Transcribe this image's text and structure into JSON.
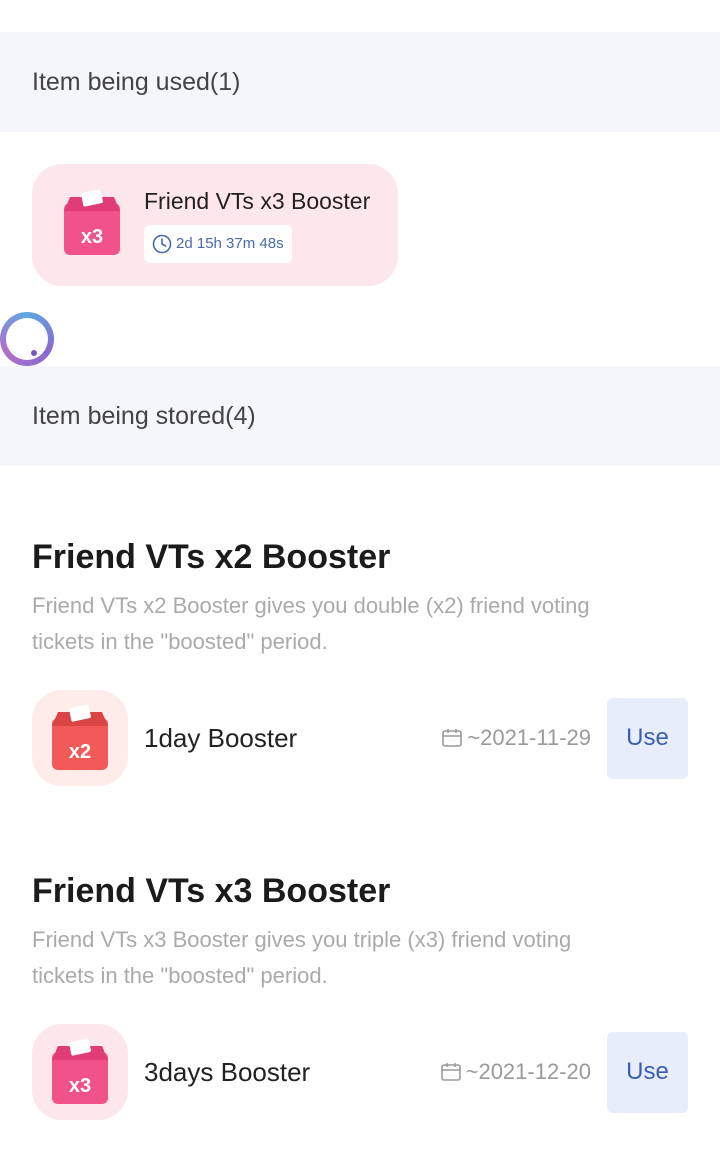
{
  "in_use": {
    "header": "Item being used(1)",
    "card": {
      "title": "Friend VTs x3 Booster",
      "timer": "2d 15h 37m 48s",
      "badge": "x3"
    }
  },
  "stored": {
    "header": "Item being stored(4)",
    "products": [
      {
        "title": "Friend VTs x2 Booster",
        "desc_line1": "Friend VTs x2 Booster gives you double (x2) friend voting",
        "desc_line2": "tickets in the \"boosted\" period.",
        "item": {
          "name": "1day Booster",
          "date": "~2021-11-29",
          "badge": "x2",
          "use_label": "Use"
        }
      },
      {
        "title": "Friend VTs x3 Booster",
        "desc_line1": "Friend VTs x3 Booster gives you triple (x3) friend voting",
        "desc_line2": "tickets in the \"boosted\" period.",
        "item": {
          "name": "3days Booster",
          "date": "~2021-12-20",
          "badge": "x3",
          "use_label": "Use"
        }
      }
    ]
  },
  "colors": {
    "x2_box": "#f25a5a",
    "x3_box": "#f2528a",
    "x3_bg": "#fde6ec",
    "x2_bg": "#fdecea",
    "accent": "#3a5eb0"
  }
}
